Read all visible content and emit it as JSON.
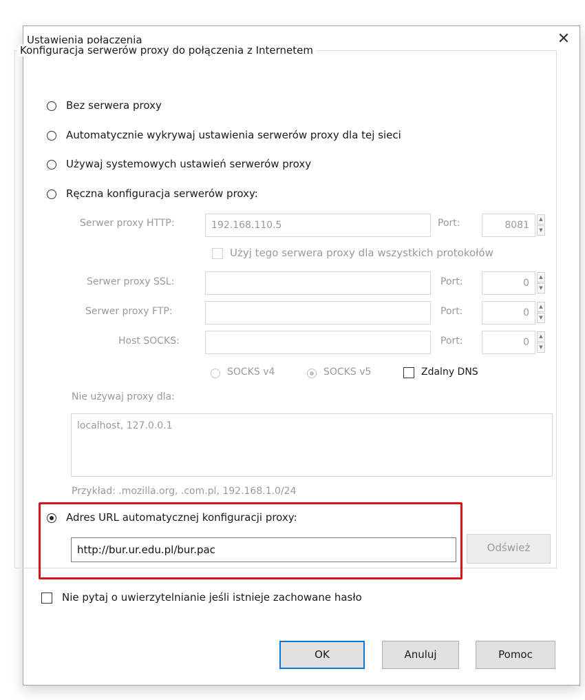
{
  "dialog": {
    "title": "Ustawienia połączenia",
    "close_glyph": "✕"
  },
  "group": {
    "legend": "Konfiguracja serwerów proxy do połączenia z Internetem"
  },
  "radios": {
    "no_proxy": "Bez serwera proxy",
    "auto_detect": "Automatycznie wykrywaj ustawienia serwerów proxy dla tej sieci",
    "system": "Używaj systemowych ustawień serwerów proxy",
    "manual": "Ręczna konfiguracja serwerów proxy:",
    "pac": "Adres URL automatycznej konfiguracji proxy:",
    "selected": "pac"
  },
  "manual": {
    "http_label": "Serwer proxy HTTP:",
    "http_value": "192.168.110.5",
    "http_port_label": "Port:",
    "http_port_value": "8081",
    "use_for_all": "Użyj tego serwera proxy dla wszystkich protokołów",
    "ssl_label": "Serwer proxy SSL:",
    "ssl_value": "",
    "ssl_port_label": "Port:",
    "ssl_port_value": "0",
    "ftp_label": "Serwer proxy FTP:",
    "ftp_value": "",
    "ftp_port_label": "Port:",
    "ftp_port_value": "0",
    "socks_label": "Host SOCKS:",
    "socks_value": "",
    "socks_port_label": "Port:",
    "socks_port_value": "0",
    "socks_v4": "SOCKS v4",
    "socks_v5": "SOCKS v5",
    "socks_selected": "v5",
    "remote_dns": "Zdalny DNS",
    "no_proxy_for_label": "Nie używaj proxy dla:",
    "no_proxy_for_value": "localhost, 127.0.0.1",
    "example": "Przykład: .mozilla.org, .com.pl, 192.168.1.0/24"
  },
  "pac": {
    "url": "http://bur.ur.edu.pl/bur.pac",
    "reload_button": "Odśwież"
  },
  "no_auth_prompt": "Nie pytaj o uwierzytelnianie jeśli istnieje zachowane hasło",
  "buttons": {
    "ok": "OK",
    "cancel": "Anuluj",
    "help": "Pomoc"
  },
  "colors": {
    "highlight": "#d8131b",
    "focus": "#0078d7"
  }
}
